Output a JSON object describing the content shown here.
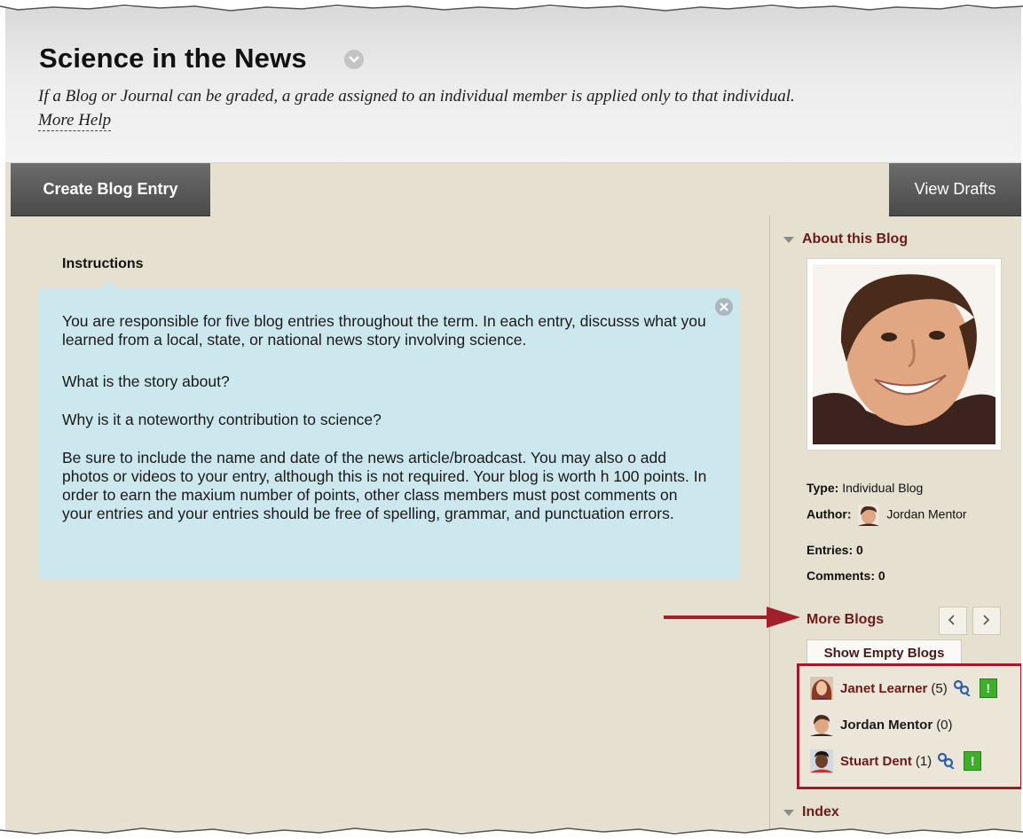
{
  "page": {
    "title": "Science in the News",
    "subtitle": "If a Blog or Journal can be graded, a grade assigned to an individual member is applied only to that individual.",
    "more_help": "More Help"
  },
  "actions": {
    "create_entry": "Create Blog Entry",
    "view_drafts": "View Drafts"
  },
  "instructions": {
    "label": "Instructions",
    "paragraphs": [
      "You are responsible for five blog entries throughout the term. In each entry, discusss what you learned from a local, state, or national news story involving science.",
      "What is the story about?",
      "Why is it a noteworthy contribution to science?",
      "Be sure to include the name and date of the news article/broadcast. You may also o add photos or videos to your entry, although this is not required. Your blog is worth h 100 points. In order to earn the maxium number of points, other class members must post comments on your entries and your entries should be free of spelling, grammar, and punctuation errors."
    ]
  },
  "sidebar": {
    "about_title": "About this Blog",
    "type_label": "Type:",
    "type_value": "Individual Blog",
    "author_label": "Author:",
    "author_value": "Jordan Mentor",
    "entries_label": "Entries:",
    "entries_value": "0",
    "comments_label": "Comments:",
    "comments_value": "0",
    "more_blogs_title": "More Blogs",
    "show_empty_label": "Show Empty Blogs",
    "blogs": [
      {
        "name": "Janet Learner",
        "count": "(5)"
      },
      {
        "name": "Jordan Mentor",
        "count": "(0)"
      },
      {
        "name": "Stuart Dent",
        "count": "(1)"
      }
    ],
    "index_title": "Index"
  },
  "icons": {
    "title_menu": "chevron-down-icon",
    "close": "close-icon",
    "prev": "chevron-left-icon",
    "next": "chevron-right-icon",
    "people": "people-link-icon",
    "alert": "needs-grading-icon"
  },
  "colors": {
    "accent": "#6b1a1a",
    "highlight_border": "#9e1b2b",
    "instruction_bg": "#cde7ef",
    "content_bg": "#e6e0d1"
  }
}
